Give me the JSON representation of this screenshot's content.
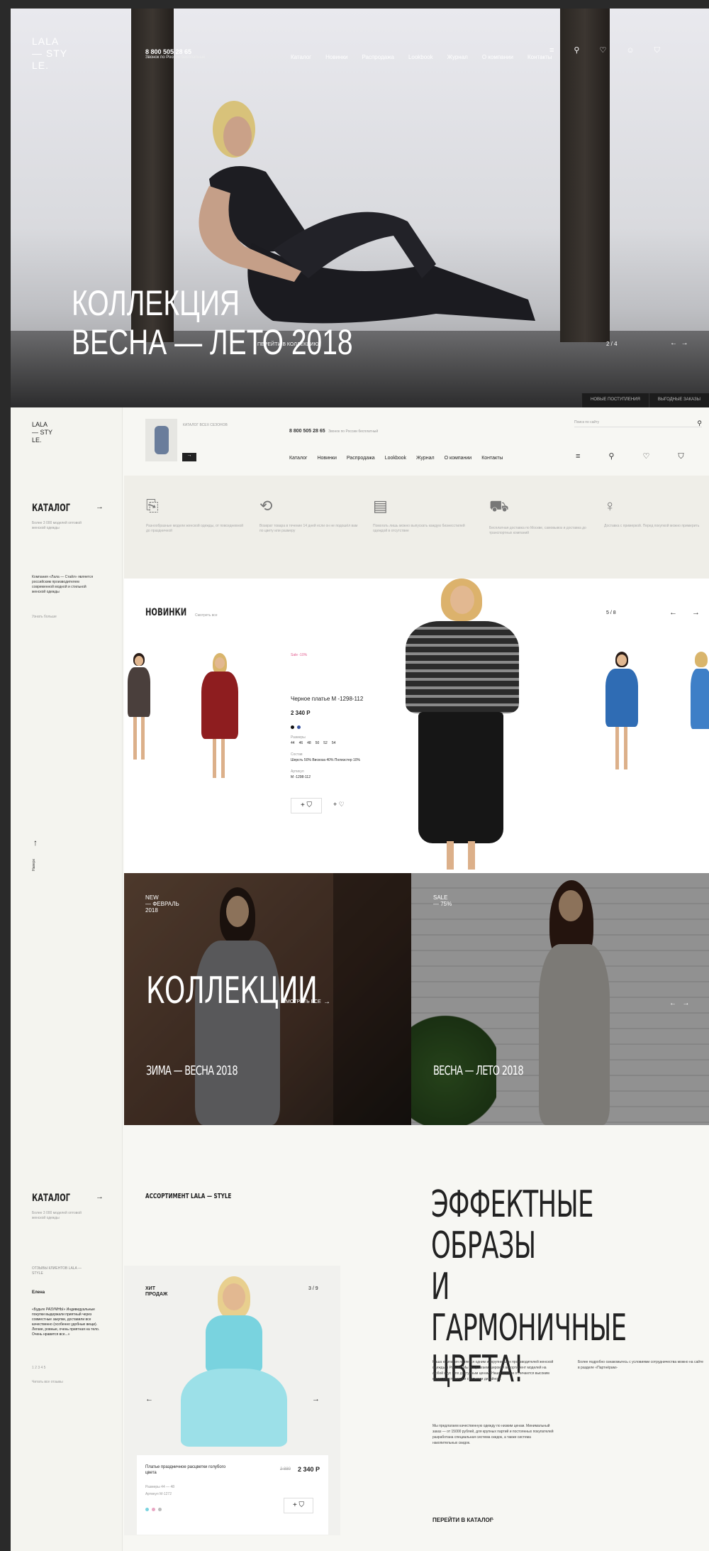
{
  "hero": {
    "logo": [
      "LALA",
      "— STY",
      "LE."
    ],
    "phone": "8 800 505 28 65",
    "phone_sub": "Звонок по России бесплатный",
    "nav": [
      "Каталог",
      "Новинки",
      "Распродажа",
      "Lookbook",
      "Журнал",
      "О компании",
      "Контакты"
    ],
    "title_lines": [
      "КОЛЛЕКЦИЯ",
      "ВЕСНА — ЛЕТО 2018"
    ],
    "title_link": "ПЕРЕЙТИ В КОЛЛЕКЦИЮ",
    "slide": "2 / 4",
    "bar": [
      "НОВЫЕ ПОСТУПЛЕНИЯ",
      "ВЫГОДНЫЕ ЗАКАЗЫ"
    ],
    "icons": [
      "menu-icon",
      "pin-icon",
      "heart-icon",
      "user-icon",
      "cart-icon"
    ]
  },
  "header": {
    "logo": [
      "LALA",
      "— STY",
      "LE."
    ],
    "catalog_label": "КАТАЛОГ ВСЕХ СЕЗОНОВ",
    "phone": "8 800 505 28 65",
    "phone_sub": "Звонок по России бесплатный",
    "search_placeholder": "Поиск по сайту",
    "nav": [
      "Каталог",
      "Новинки",
      "Распродажа",
      "Lookbook",
      "Журнал",
      "О компании",
      "Контакты"
    ]
  },
  "sidebar": {
    "catalog": "КАТАЛОГ",
    "catalog_sub": "Более 3 000 моделей оптовой женской одежды",
    "about": "Компания «Лала — Стайл» является российским производителем современной модной и стильной женской одежды",
    "about_link": "Узнать больше",
    "up_label": "Наверх",
    "catalog2": "КАТАЛОГ",
    "catalog2_sub": "Более 3 000 моделей оптовой женской одежды",
    "reviews_title": "ОТЗЫВЫ КЛИЕНТОВ LALA — STYLE",
    "review_author": "Елена",
    "review_text": "«Будьте РАЗУМНЫ» Индивидуальные покупки выдержали приятный через совместные закупки, доставили все качественно (особенно удобные вещи). Легкие, ровные, очень приятная на тело. Очень нравится все...»",
    "review_pages": "1 2 3 4 5",
    "review_link": "Читать все отзывы"
  },
  "features": [
    {
      "icon": "tag-icon",
      "text": "Разнообразные модели женской одежды, от повседневной до праздничной"
    },
    {
      "icon": "return-icon",
      "text": "Возврат товара в течение 14 дней если он не подошёл вам по цвету или размеру"
    },
    {
      "icon": "doc-icon",
      "text": "Помогать лишь можно выпускать каждую бизнесстилей одеждой в отсутствие"
    },
    {
      "icon": "truck-icon",
      "text": "Бесплатная доставка по Москве, самовывоз и доставка до транспортных компаний"
    },
    {
      "icon": "dress-icon",
      "text": "Доставка с примеркой. Перед покупкой можно примерить"
    }
  ],
  "new": {
    "title": "НОВИНКИ",
    "sub": "Смотреть все",
    "badge": "Sale -10%",
    "product": "Черное платье М -1298-112",
    "price": "2 340 Р",
    "sizes_label": "Размеры",
    "sizes": [
      "44",
      "46",
      "48",
      "50",
      "52",
      "54"
    ],
    "composition_label": "Состав",
    "composition": "Шерсть 50% Вискоза 40% Полиэстер 10%",
    "article_label": "Артикул",
    "article": "М -1298-112",
    "counter": "5 / 8"
  },
  "collections": {
    "left_tag": [
      "NEW",
      "— ФЕВРАЛЬ",
      "2018"
    ],
    "title": "КОЛЛЕКЦИИ",
    "view_all": "СМОТРЕТЬ ВСЕ",
    "left_name": "ЗИМА — ВЕСНА 2018",
    "right_tag": [
      "SALE",
      "— 75%"
    ],
    "right_name": "ВЕСНА — ЛЕТО 2018"
  },
  "assortment": {
    "label": "АССОРТИМЕНТ LALA — STYLE",
    "tag": [
      "ХИТ",
      "ПРОДАЖ"
    ],
    "counter": "3 / 9",
    "product": "Платье праздничное расцветки голубого цвета",
    "old_price": "2 880",
    "price": "2 340 Р",
    "sizes": "Размеры 44 — 48",
    "article": "Артикул М-1272"
  },
  "promo": {
    "title": [
      "ЭФФЕКТНЫЕ ОБРАЗЫ",
      "И ГАРМОНИЧНЫЕ",
      "ЦВЕТА!"
    ],
    "p1": "Наша компания является одним из крупнейших производителей женской одежды в России. Мы предлагаем широкий ассортимент моделей на любой вкус и по доступным ценам. Наши модели отличаются высоким качеством пошива и стильным дизайном.",
    "p2": "Мы предлагаем качественную одежду по низким ценам. Минимальный заказ — от 15000 рублей, для крупных партий и постоянных покупателей разработана специальная система скидок, а также система накопительных скидок.",
    "side": "Более подробно ознакомьтесь с условиями сотрудничества можно на сайте в разделе «Партнёрам»",
    "cta": "ПЕРЕЙТИ В КАТАЛОГ"
  },
  "colors": {
    "accent": "#e25c8f",
    "dark": "#1c1c1c",
    "hero_sky": "#dcdde1"
  }
}
